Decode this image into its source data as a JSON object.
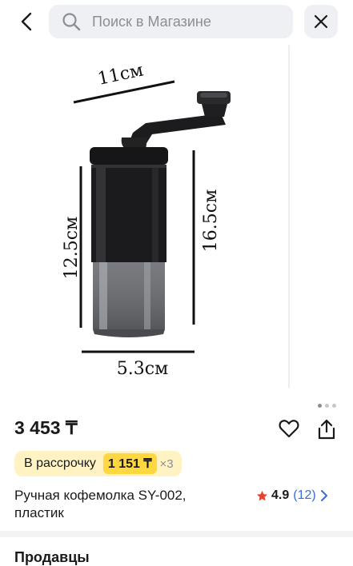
{
  "header": {
    "search_placeholder": "Поиск в Магазине"
  },
  "product": {
    "image_annotations": {
      "width": "11см",
      "height_body": "12.5см",
      "height_total": "16.5см",
      "diameter": "5.3см"
    },
    "gallery": {
      "page_count": 3,
      "active_index": 0
    },
    "price": "3 453 ₸",
    "installment": {
      "label": "В рассрочку",
      "amount": "1 151 ₸",
      "multiplier": "×3"
    },
    "title": "Ручная кофемолка SY-002, пластик",
    "rating": {
      "value": "4.9",
      "count": "(12)",
      "star_color": "#e8432e"
    }
  },
  "sellers": {
    "title": "Продавцы"
  },
  "colors": {
    "accent_yellow": "#ffd740",
    "installment_bg": "#fff3c4",
    "link_blue": "#3d6bd9",
    "search_bg": "#eff0f3"
  },
  "icons": [
    "chevron-left-icon",
    "search-icon",
    "close-icon",
    "heart-icon",
    "share-icon",
    "star-icon",
    "chevron-right-icon"
  ]
}
